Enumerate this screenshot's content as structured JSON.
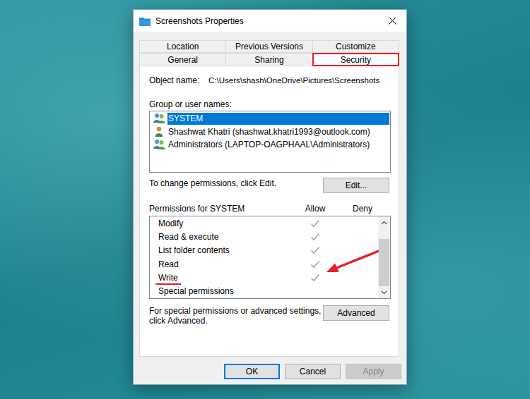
{
  "window": {
    "title": "Screenshots Properties"
  },
  "tabs": [
    [
      {
        "label": "Location",
        "selected": false,
        "annotated": false
      },
      {
        "label": "Previous Versions",
        "selected": false,
        "annotated": false
      },
      {
        "label": "Customize",
        "selected": false,
        "annotated": false
      }
    ],
    [
      {
        "label": "General",
        "selected": false,
        "annotated": false
      },
      {
        "label": "Sharing",
        "selected": false,
        "annotated": false
      },
      {
        "label": "Security",
        "selected": true,
        "annotated": true
      }
    ]
  ],
  "object_name": {
    "label": "Object name:",
    "value": "C:\\Users\\shash\\OneDrive\\Pictures\\Screenshots"
  },
  "groups": {
    "label": "Group or user names:",
    "items": [
      {
        "name": "SYSTEM",
        "kind": "group",
        "selected": true
      },
      {
        "name": "Shashwat Khatri (shashwat.khatri1993@outlook.com)",
        "kind": "user",
        "selected": false
      },
      {
        "name": "Administrators (LAPTOP-OAGPHAAL\\Administrators)",
        "kind": "group",
        "selected": false
      }
    ]
  },
  "edit": {
    "hint": "To change permissions, click Edit.",
    "button": "Edit..."
  },
  "permissions": {
    "label": "Permissions for SYSTEM",
    "columns": [
      "Allow",
      "Deny"
    ],
    "rows": [
      {
        "name": "Modify",
        "allow": true,
        "deny": false,
        "annotated": false
      },
      {
        "name": "Read & execute",
        "allow": true,
        "deny": false,
        "annotated": false
      },
      {
        "name": "List folder contents",
        "allow": true,
        "deny": false,
        "annotated": false
      },
      {
        "name": "Read",
        "allow": true,
        "deny": false,
        "annotated": false
      },
      {
        "name": "Write",
        "allow": true,
        "deny": false,
        "annotated": true
      },
      {
        "name": "Special permissions",
        "allow": false,
        "deny": false,
        "annotated": false
      }
    ],
    "scrollbar": {
      "offset": 0.18,
      "size": 0.82
    }
  },
  "advanced": {
    "hint": "For special permissions or advanced settings, click Advanced.",
    "button": "Advanced"
  },
  "buttons": [
    {
      "label": "OK",
      "default": true,
      "disabled": false
    },
    {
      "label": "Cancel",
      "default": false,
      "disabled": false
    },
    {
      "label": "Apply",
      "default": false,
      "disabled": true
    }
  ]
}
